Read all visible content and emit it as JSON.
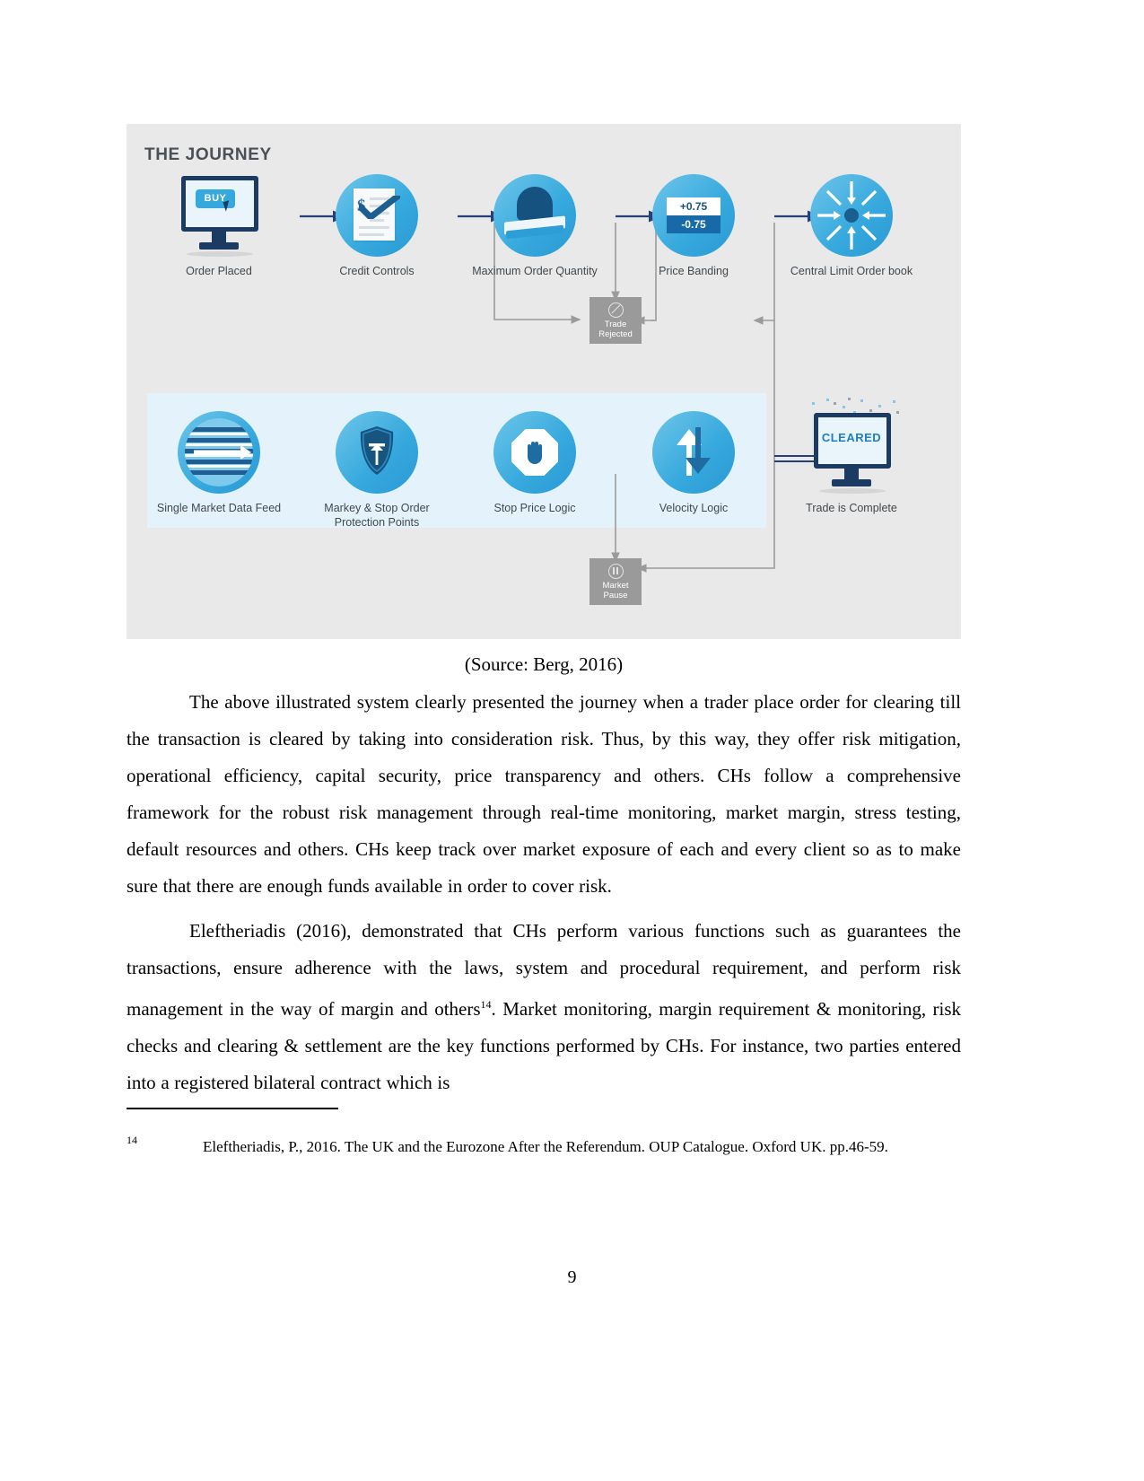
{
  "figure": {
    "title": "THE JOURNEY",
    "top_row": [
      {
        "label": "Order Placed",
        "icon": "monitor-buy-icon",
        "badge": "BUY"
      },
      {
        "label": "Credit Controls",
        "icon": "document-checkmark-icon"
      },
      {
        "label": "Maximum Order Quantity",
        "icon": "scanner-icon"
      },
      {
        "label": "Price Banding",
        "icon": "price-band-icon",
        "value_up": "+0.75",
        "value_down": "-0.75"
      },
      {
        "label": "Central Limit Order book",
        "icon": "inward-arrows-hub-icon"
      }
    ],
    "bottom_row": [
      {
        "label": "Single Market Data Feed",
        "icon": "globe-data-feed-icon"
      },
      {
        "label": "Markey & Stop Order Protection Points",
        "icon": "shield-uparrow-icon"
      },
      {
        "label": "Stop Price Logic",
        "icon": "stop-hand-icon"
      },
      {
        "label": "Velocity Logic",
        "icon": "up-down-arrows-icon"
      },
      {
        "label": "Trade is Complete",
        "icon": "monitor-cleared-icon",
        "badge": "CLEARED"
      }
    ],
    "reject_boxes": [
      {
        "label_line1": "Trade",
        "label_line2": "Rejected",
        "icon": "no-entry-icon"
      },
      {
        "label_line1": "Market",
        "label_line2": "Pause",
        "icon": "pause-icon"
      }
    ]
  },
  "document": {
    "source_caption": "(Source: Berg, 2016)",
    "paragraph_1": "The above illustrated system clearly presented the journey when a trader place order for clearing till the transaction is cleared by taking into consideration risk. Thus, by this way, they offer risk mitigation, operational efficiency, capital security, price transparency and others. CHs follow a comprehensive framework for the robust risk management through real-time monitoring, market margin, stress testing, default resources and others. CHs keep track over market exposure of each and every client so as to make sure that there are enough funds available in order to cover risk.",
    "paragraph_2_part1": "Eleftheriadis (2016), demonstrated that CHs perform various functions such as guarantees the transactions, ensure adherence with the laws, system and procedural requirement, and perform risk management in the way of margin and others",
    "paragraph_2_ref": "14",
    "paragraph_2_part2": ". Market monitoring, margin requirement & monitoring, risk checks and clearing & settlement are the key functions performed by CHs. For instance, two parties entered into a registered bilateral contract which is",
    "footnote_number": "14",
    "footnote_text": "Eleftheriadis, P., 2016. The UK and the Eurozone After the Referendum. OUP Catalogue. Oxford UK.  pp.46-59.",
    "page_number": "9"
  },
  "colors": {
    "figure_bg": "#e9e9e9",
    "band_bg": "#e4f3fb",
    "accent_blue": "#35a8dd",
    "dark_blue": "#1b3b63",
    "gray_box": "#9a9a9a",
    "arrow_navy": "#27407a",
    "connector_gray": "#9b9b9b"
  }
}
